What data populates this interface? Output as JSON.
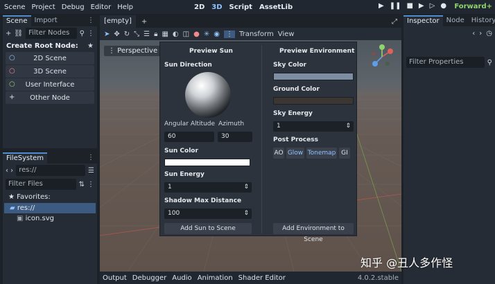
{
  "menu": [
    "Scene",
    "Project",
    "Debug",
    "Editor",
    "Help"
  ],
  "modes": [
    {
      "label": "2D",
      "active": false
    },
    {
      "label": "3D",
      "active": true
    },
    {
      "label": "Script",
      "active": false
    },
    {
      "label": "AssetLib",
      "active": false
    }
  ],
  "renderer": "Forward+",
  "scene_dock": {
    "tabs": [
      "Scene",
      "Import"
    ],
    "filter_placeholder": "Filter Nodes",
    "create_root": "Create Root Node:",
    "nodes": [
      {
        "label": "2D Scene",
        "icon": "○",
        "color": "#8fc3ff"
      },
      {
        "label": "3D Scene",
        "icon": "○",
        "color": "#f08a8a"
      },
      {
        "label": "User Interface",
        "icon": "○",
        "color": "#8fd46c"
      },
      {
        "label": "Other Node",
        "icon": "+",
        "color": "#e0e4ea"
      }
    ]
  },
  "filesystem": {
    "tab": "FileSystem",
    "path": "res://",
    "filter_placeholder": "Filter Files",
    "favorites": "Favorites:",
    "items": [
      "res://",
      "icon.svg"
    ]
  },
  "scene_tabs": [
    "[empty]"
  ],
  "viewport": {
    "perspective": "Perspective",
    "transform": "Transform",
    "view": "View"
  },
  "preview_sun": {
    "title": "Preview Sun",
    "sun_direction": "Sun Direction",
    "angular_altitude": "Angular Altitude",
    "azimuth": "Azimuth",
    "altitude_value": "60",
    "azimuth_value": "30",
    "sun_color": "Sun Color",
    "sun_energy": "Sun Energy",
    "sun_energy_value": "1",
    "shadow_max": "Shadow Max Distance",
    "shadow_max_value": "100",
    "add_button": "Add Sun to Scene"
  },
  "preview_env": {
    "title": "Preview Environment",
    "sky_color": "Sky Color",
    "ground_color": "Ground Color",
    "sky_energy": "Sky Energy",
    "sky_energy_value": "1",
    "post_process": "Post Process",
    "toggles": [
      {
        "label": "AO",
        "on": false
      },
      {
        "label": "Glow",
        "on": true
      },
      {
        "label": "Tonemap",
        "on": true
      },
      {
        "label": "GI",
        "on": false
      }
    ],
    "add_button": "Add Environment to Scene"
  },
  "inspector": {
    "tabs": [
      "Inspector",
      "Node",
      "History"
    ],
    "filter_placeholder": "Filter Properties"
  },
  "bottom": {
    "tabs": [
      "Output",
      "Debugger",
      "Audio",
      "Animation",
      "Shader Editor"
    ],
    "version": "4.0.2.stable"
  },
  "watermark": "知乎 @丑人多作怪",
  "colors": {
    "sky": "#7d8ea3",
    "ground": "#3c3632",
    "accent": "#8fc3ff"
  }
}
